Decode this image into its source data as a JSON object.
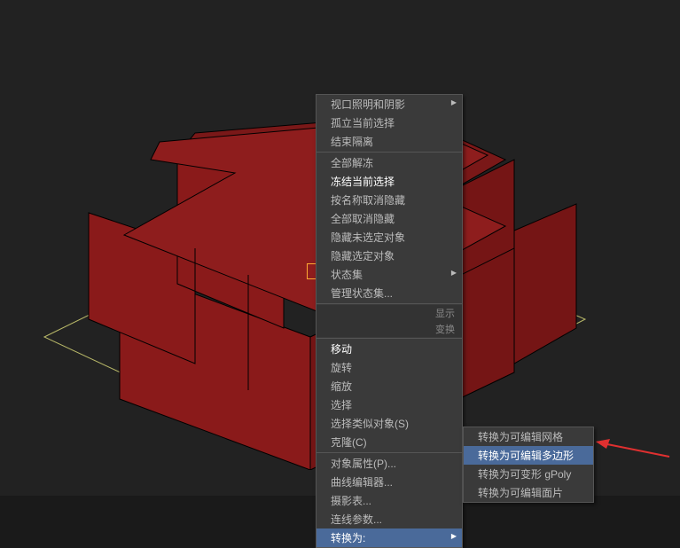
{
  "menu": {
    "items": [
      {
        "label": "视口照明和阴影",
        "kind": "arrow"
      },
      {
        "label": "孤立当前选择",
        "kind": "normal"
      },
      {
        "label": "结束隔离",
        "kind": "normal"
      },
      {
        "kind": "sep"
      },
      {
        "label": "全部解冻",
        "kind": "normal"
      },
      {
        "label": "冻结当前选择",
        "kind": "white"
      },
      {
        "label": "按名称取消隐藏",
        "kind": "normal"
      },
      {
        "label": "全部取消隐藏",
        "kind": "normal"
      },
      {
        "label": "隐藏未选定对象",
        "kind": "normal"
      },
      {
        "label": "隐藏选定对象",
        "kind": "normal"
      },
      {
        "label": "状态集",
        "kind": "arrow"
      },
      {
        "label": "管理状态集...",
        "kind": "normal"
      },
      {
        "kind": "sep"
      },
      {
        "label": "显示",
        "kind": "small"
      },
      {
        "label": "变换",
        "kind": "small"
      },
      {
        "kind": "sep"
      },
      {
        "label": "移动",
        "kind": "white"
      },
      {
        "label": "旋转",
        "kind": "normal"
      },
      {
        "label": "缩放",
        "kind": "normal"
      },
      {
        "label": "选择",
        "kind": "normal"
      },
      {
        "label": "选择类似对象(S)",
        "kind": "normal"
      },
      {
        "label": "克隆(C)",
        "kind": "normal"
      },
      {
        "kind": "sep"
      },
      {
        "label": "对象属性(P)...",
        "kind": "normal"
      },
      {
        "label": "曲线编辑器...",
        "kind": "normal"
      },
      {
        "label": "摄影表...",
        "kind": "normal"
      },
      {
        "label": "连线参数...",
        "kind": "normal"
      },
      {
        "label": "转换为:",
        "kind": "highlighted-arrow"
      }
    ]
  },
  "submenu": {
    "items": [
      {
        "label": "转换为可编辑网格",
        "highlighted": false
      },
      {
        "label": "转换为可编辑多边形",
        "highlighted": true
      },
      {
        "label": "转换为可变形 gPoly",
        "highlighted": false
      },
      {
        "label": "转换为可编辑面片",
        "highlighted": false
      }
    ]
  }
}
